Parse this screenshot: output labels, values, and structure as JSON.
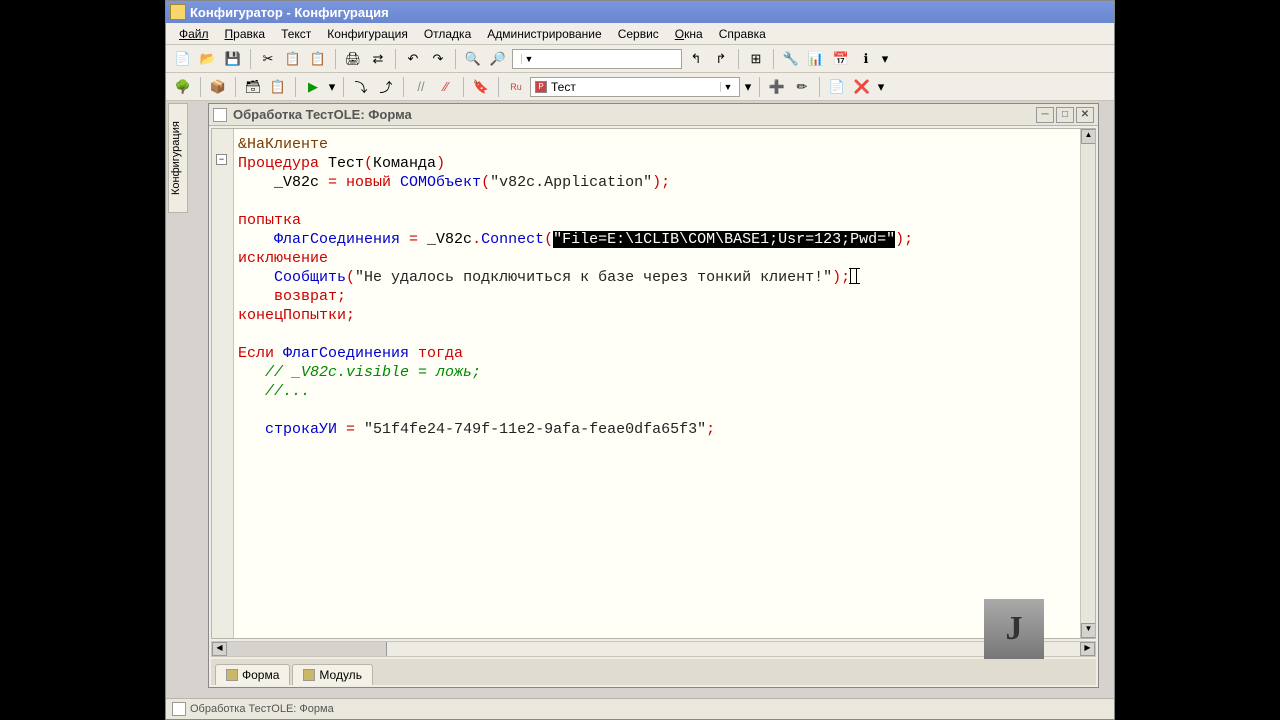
{
  "window_title": "Конфигуратор - Конфигурация",
  "menus": [
    "Файл",
    "Правка",
    "Текст",
    "Конфигурация",
    "Отладка",
    "Администрирование",
    "Сервис",
    "Окна",
    "Справка"
  ],
  "toolbar2_combo": "Тест",
  "doc_title": "Обработка ТестOLE: Форма",
  "sidetab_label": "Конфигурация",
  "tabs": {
    "form": "Форма",
    "module": "Модуль"
  },
  "statusbar_text": "Обработка ТестOLE: Форма",
  "watermark": "J",
  "code": {
    "l1_amp": "&",
    "l1": "НаКлиенте",
    "l2_proc": "Процедура",
    "l2_name": " Тест",
    "l2_arg": "Команда",
    "l3_var": "    _V82c",
    "l3_eq": " = ",
    "l3_new": "новый",
    "l3_com": " COMОбъект",
    "l3_str": "\"v82c.Application\"",
    "l5": "попытка",
    "l6_var": "    ФлагСоединения",
    "l6_eq": " = ",
    "l6_obj": "_V82c",
    "l6_dot": ".",
    "l6_m": "Connect",
    "l6_strhl": "\"File=E:\\1CLIB\\COM\\BASE1;Usr=123;Pwd=\"",
    "l7": "исключение",
    "l8_fn": "    Сообщить",
    "l8_str": "\"Не удалось подключиться к базе через тонкий клиент!\"",
    "l9": "    возврат",
    "l10": "конецПопытки",
    "l12_if": "Если",
    "l12_var": " ФлагСоединения ",
    "l12_then": "тогда",
    "l13": "   // _V82c.visible = ложь;",
    "l14": "   //...",
    "l16_var": "   строкаУИ",
    "l16_eq": " = ",
    "l16_str": "\"51f4fe24-749f-11e2-9afa-feae0dfa65f3\""
  }
}
